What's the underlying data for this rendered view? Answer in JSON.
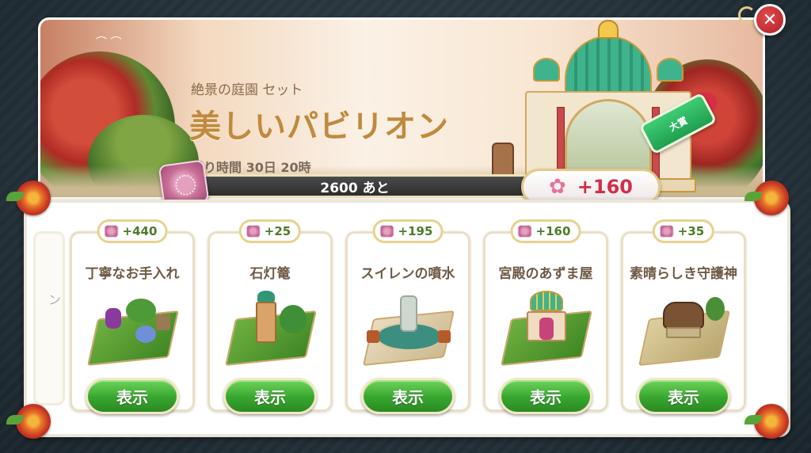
{
  "banner": {
    "subtitle": "絶景の庭園 セット",
    "title": "美しいパビリオン",
    "time_remaining": "残り時間 30日 20時",
    "ribbon_label": "大賞"
  },
  "progress": {
    "label": "2600 あと",
    "reward": "+160",
    "fill_fraction": 0.02
  },
  "items_partial": {
    "text": "ン"
  },
  "items": [
    {
      "name": "丁寧なお手入れ",
      "points": "+440",
      "button": "表示"
    },
    {
      "name": "石灯篭",
      "points": "+25",
      "button": "表示"
    },
    {
      "name": "スイレンの噴水",
      "points": "+195",
      "button": "表示"
    },
    {
      "name": "宮殿のあずま屋",
      "points": "+160",
      "button": "表示"
    },
    {
      "name": "素晴らしき守護神",
      "points": "+35",
      "button": "表示"
    }
  ],
  "colors": {
    "button_green": "#37a62f",
    "reward_red": "#d0304a",
    "title_gold": "#c08a3e",
    "close_red": "#c8232f"
  },
  "icons": [
    "cushion-currency-icon",
    "flower-icon",
    "close-icon",
    "marigold-icon"
  ]
}
